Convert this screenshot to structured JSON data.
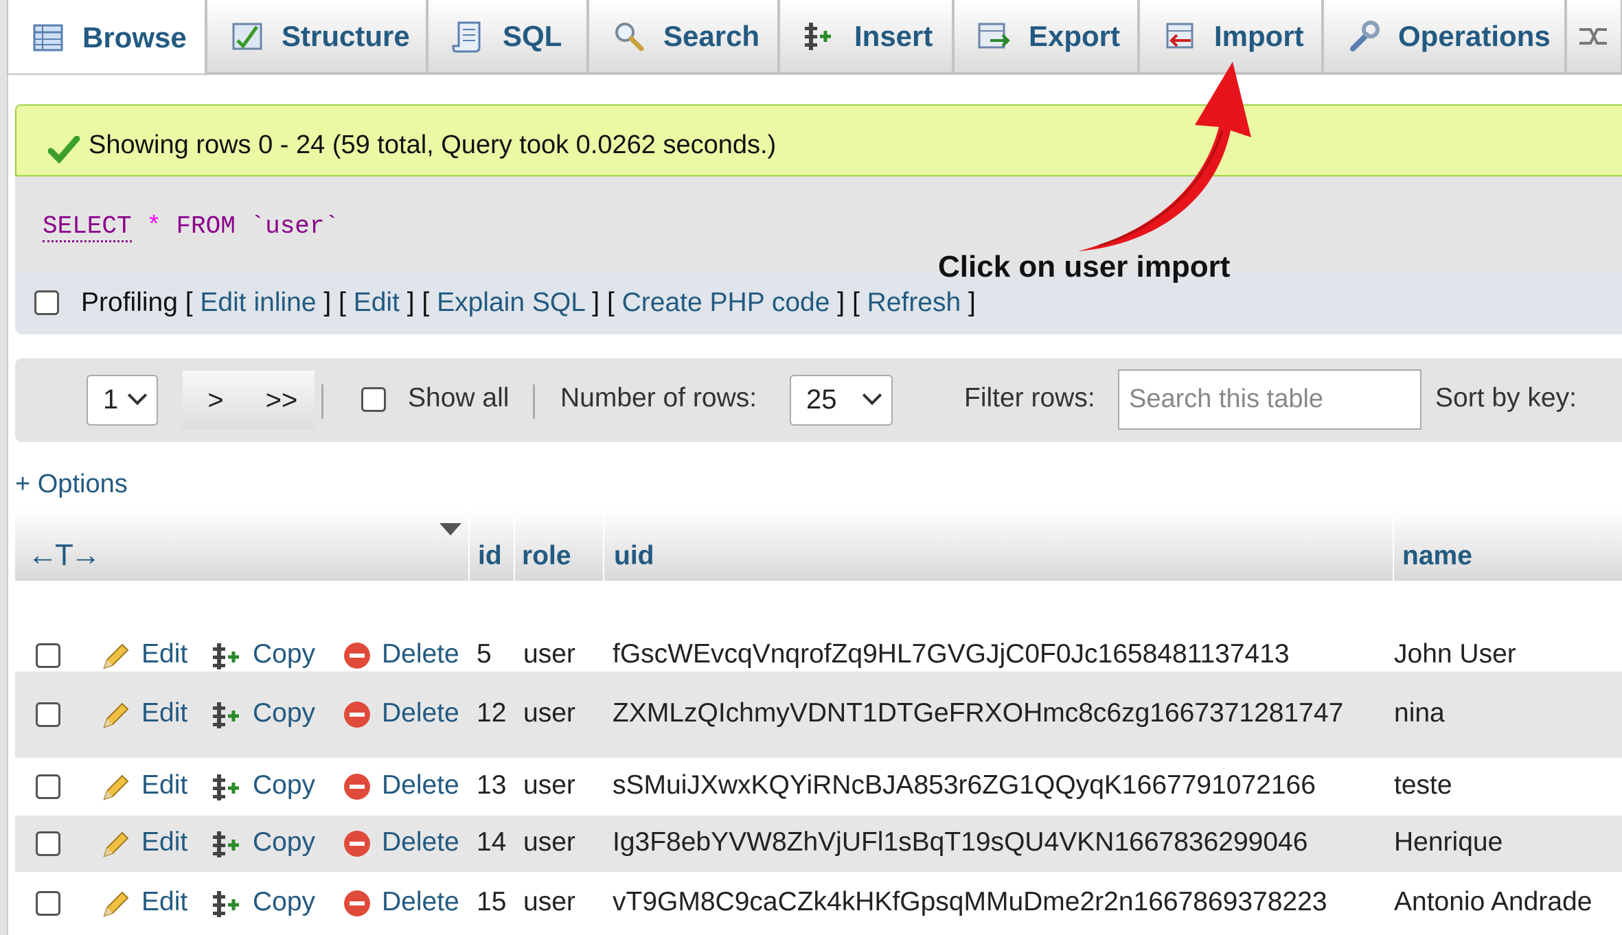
{
  "tabs": [
    {
      "label": "Browse",
      "icon": "browse-table-icon"
    },
    {
      "label": "Structure",
      "icon": "structure-icon"
    },
    {
      "label": "SQL",
      "icon": "sql-scroll-icon"
    },
    {
      "label": "Search",
      "icon": "magnifier-icon"
    },
    {
      "label": "Insert",
      "icon": "insert-icon"
    },
    {
      "label": "Export",
      "icon": "export-icon"
    },
    {
      "label": "Import",
      "icon": "import-icon"
    },
    {
      "label": "Operations",
      "icon": "wrench-icon"
    }
  ],
  "success": {
    "message": "Showing rows 0 - 24 (59 total, Query took 0.0262 seconds.)"
  },
  "query": {
    "select": "SELECT",
    "star": "*",
    "from": "FROM",
    "table": "`user`"
  },
  "profiling": {
    "label": "Profiling",
    "links": [
      "Edit inline",
      "Edit",
      "Explain SQL",
      "Create PHP code",
      "Refresh"
    ]
  },
  "navigation": {
    "page": "1",
    "next": ">",
    "last": ">>",
    "show_all": "Show all",
    "num_rows_label": "Number of rows:",
    "num_rows_value": "25",
    "filter_label": "Filter rows:",
    "filter_placeholder": "Search this table",
    "sort_label": "Sort by key:"
  },
  "options_link": "+ Options",
  "table": {
    "columns": [
      "id",
      "role",
      "uid",
      "name"
    ],
    "actions": {
      "edit": "Edit",
      "copy": "Copy",
      "delete": "Delete"
    },
    "rows": [
      {
        "id": "5",
        "role": "user",
        "uid": "fGscWEvcqVnqrofZq9HL7GVGJjC0F0Jc1658481137413",
        "name": "John User"
      },
      {
        "id": "12",
        "role": "user",
        "uid": "ZXMLzQIchmyVDNT1DTGeFRXOHmc8c6zg1667371281747",
        "name": "nina"
      },
      {
        "id": "13",
        "role": "user",
        "uid": "sSMuiJXwxKQYiRNcBJA853r6ZG1QQyqK1667791072166",
        "name": "teste"
      },
      {
        "id": "14",
        "role": "user",
        "uid": "Ig3F8ebYVW8ZhVjUFl1sBqT19sQU4VKN1667836299046",
        "name": "Henrique"
      },
      {
        "id": "15",
        "role": "user",
        "uid": "vT9GM8C9caCZk4kHKfGpsqMMuDme2r2n1667869378223",
        "name": "Antonio Andrade"
      }
    ]
  },
  "annotation": {
    "text": "Click on user import",
    "arrow_color": "#e8141b"
  }
}
